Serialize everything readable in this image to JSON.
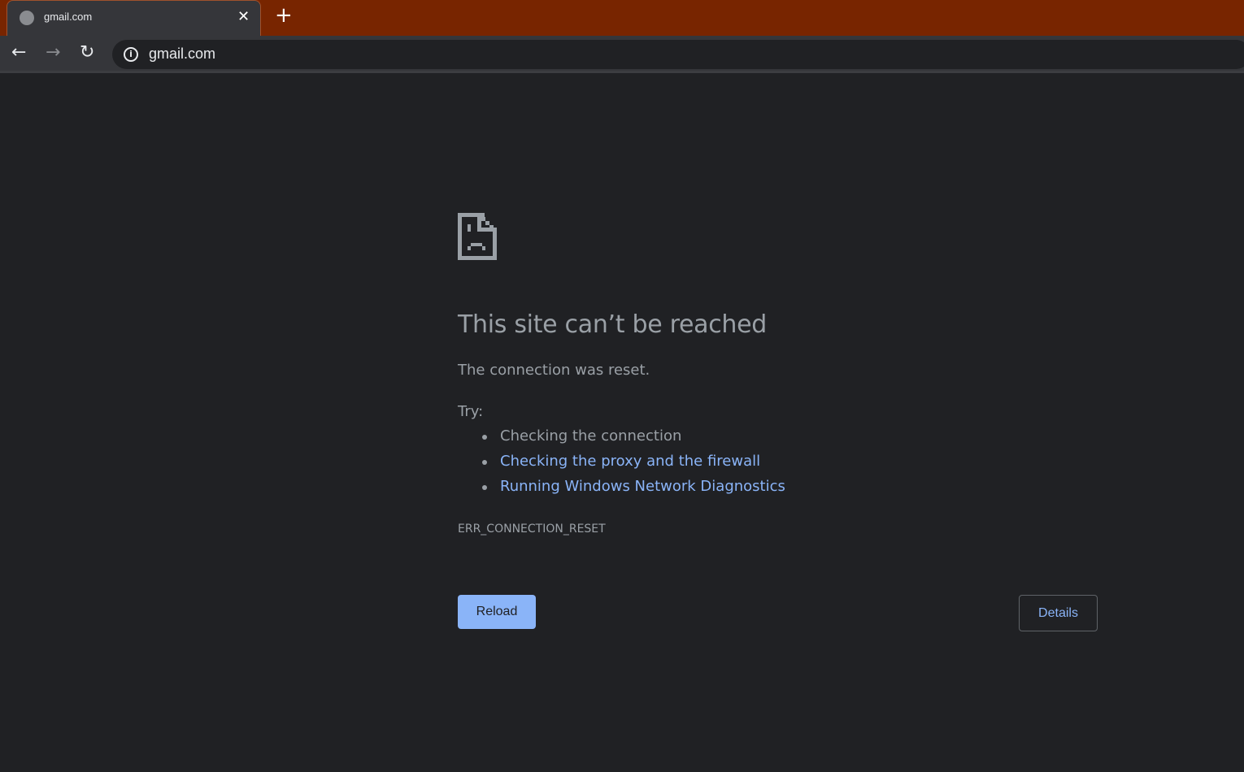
{
  "tab": {
    "title": "gmail.com",
    "favicon": "globe-icon"
  },
  "toolbar": {
    "url": "gmail.com",
    "icons": [
      "back-icon",
      "forward-icon",
      "reload-icon",
      "info-icon"
    ]
  },
  "error": {
    "icon": "sad-page-icon",
    "title": "This site can’t be reached",
    "message": "The connection was reset.",
    "try_label": "Try:",
    "suggestions": [
      "Checking the connection",
      "Checking the proxy and the firewall",
      "Running Windows Network Diagnostics"
    ],
    "code": "ERR_CONNECTION_RESET",
    "reload_label": "Reload",
    "details_label": "Details"
  },
  "colors": {
    "tabstrip": "#782500",
    "background": "#202124",
    "link": "#8ab4f8",
    "text": "#9aa0a6"
  }
}
